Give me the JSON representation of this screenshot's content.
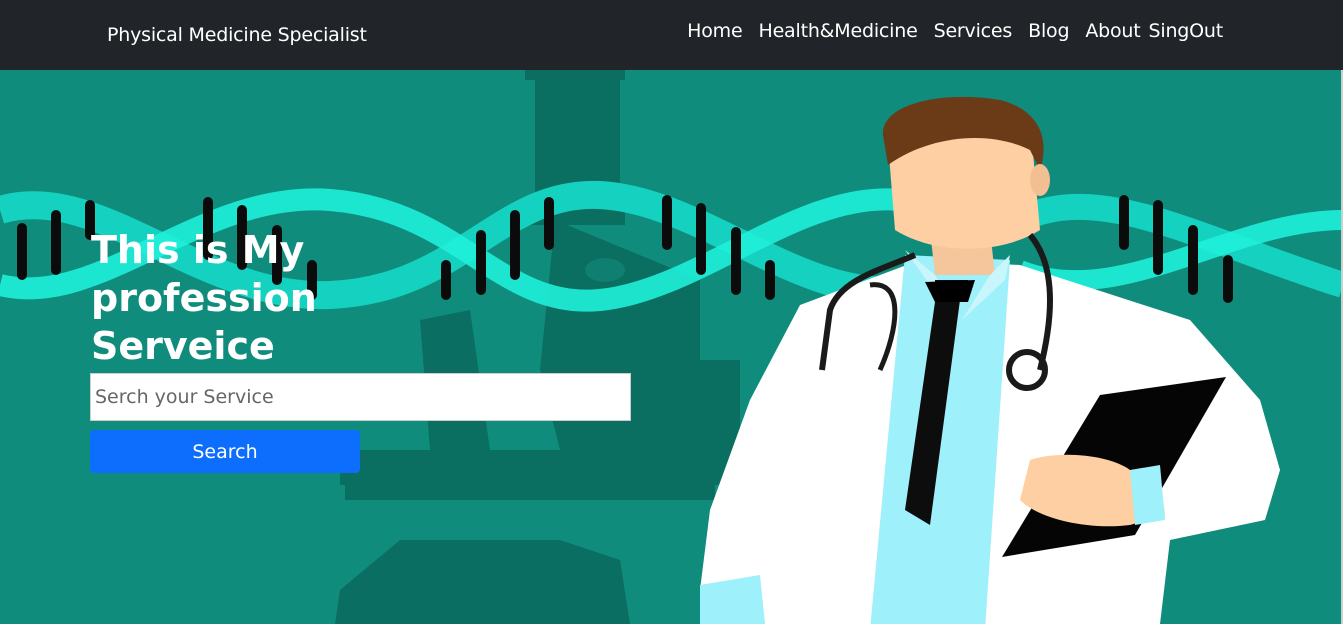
{
  "navbar": {
    "brand": "Physical Medicine Specialist",
    "links": [
      "Home",
      "Health&Medicine",
      "Services",
      "Blog",
      "About",
      "SingOut"
    ]
  },
  "hero": {
    "heading": "This is My profession Serveice",
    "search": {
      "placeholder": "Serch your Service",
      "value": ""
    },
    "button_label": "Search"
  },
  "colors": {
    "navbar_bg": "#212529",
    "hero_bg": "#108c7d",
    "button_bg": "#0d6efd"
  }
}
